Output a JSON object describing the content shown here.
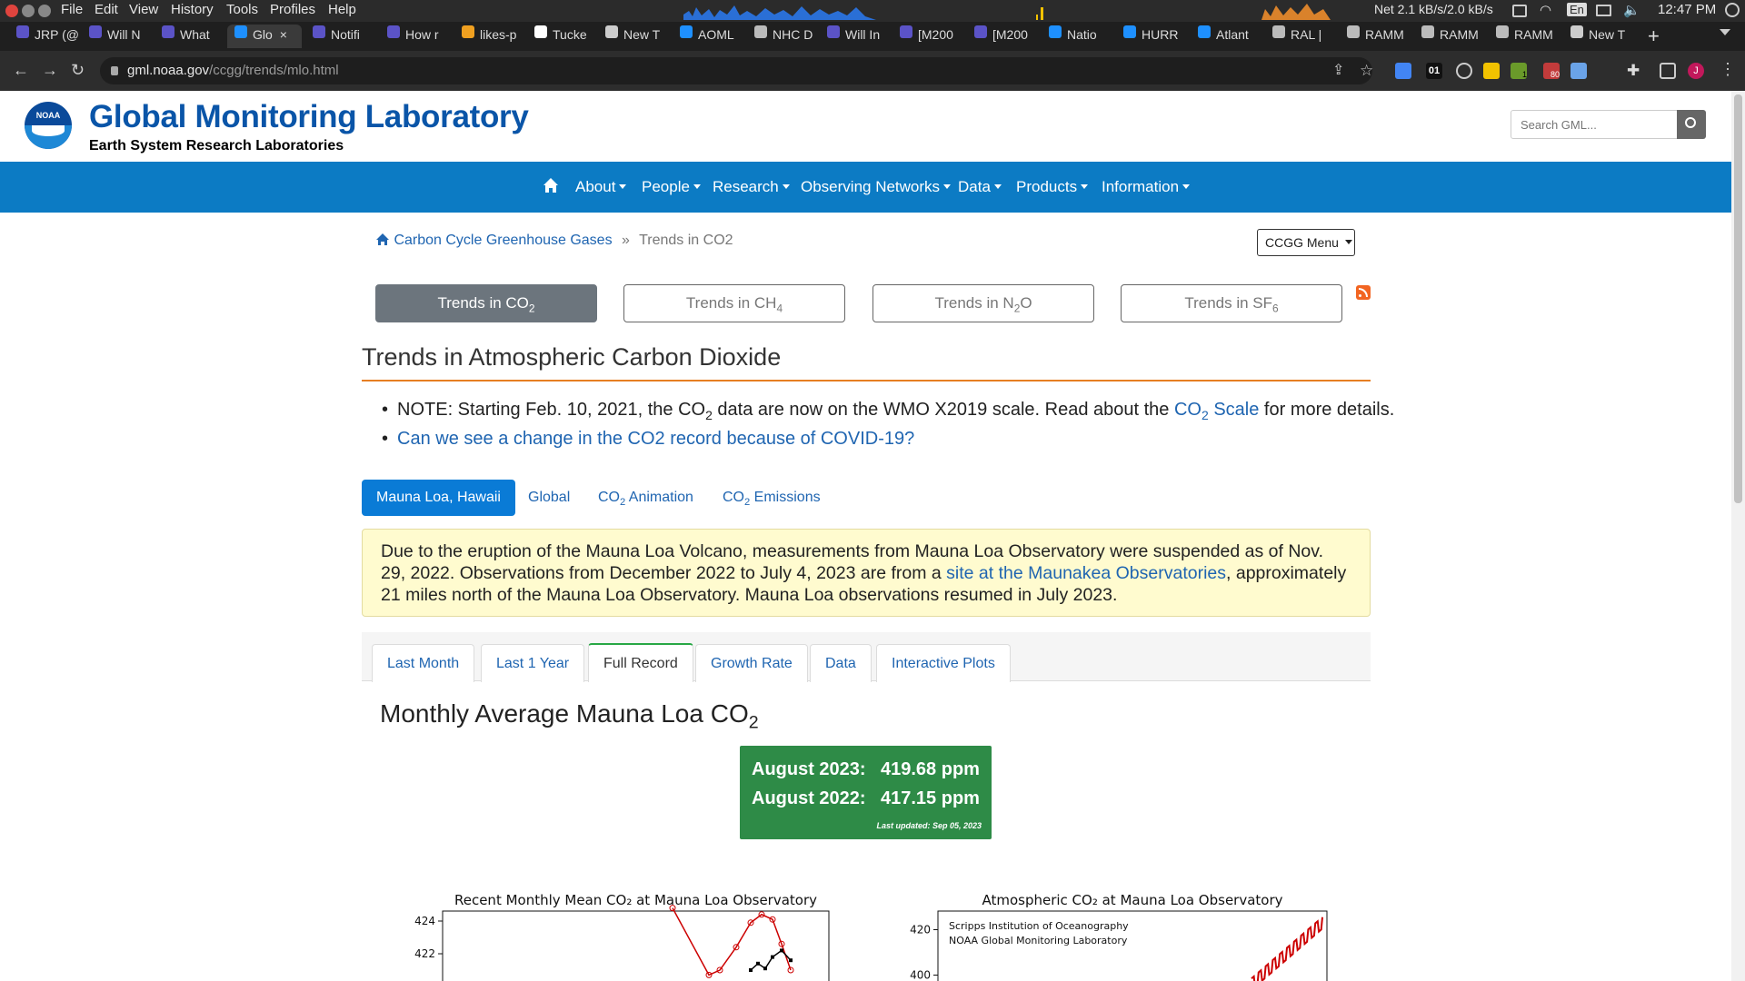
{
  "os": {
    "menu": [
      "File",
      "Edit",
      "View",
      "History",
      "Tools",
      "Profiles",
      "Help"
    ],
    "net": "Net 2.1 kB/s/2.0 kB/s",
    "lang": "En",
    "clock": "12:47 PM"
  },
  "tabs": [
    {
      "label": "JRP (@",
      "color": "#5b53c7"
    },
    {
      "label": "Will N",
      "color": "#5b53c7"
    },
    {
      "label": "What",
      "color": "#5b53c7"
    },
    {
      "label": "Glo",
      "color": "#1e90ff",
      "active": true
    },
    {
      "label": "Notifi",
      "color": "#5b53c7"
    },
    {
      "label": "How r",
      "color": "#5b53c7"
    },
    {
      "label": "likes-p",
      "color": "#f0a020"
    },
    {
      "label": "Tucke",
      "color": "#ffffff"
    },
    {
      "label": "New T",
      "color": "#cccccc"
    },
    {
      "label": "AOML",
      "color": "#1e90ff"
    },
    {
      "label": "NHC D",
      "color": "#bbbbbb"
    },
    {
      "label": "Will In",
      "color": "#5b53c7"
    },
    {
      "label": "[M200",
      "color": "#5b53c7"
    },
    {
      "label": "[M200",
      "color": "#5b53c7"
    },
    {
      "label": "Natio",
      "color": "#1e90ff"
    },
    {
      "label": "HURR",
      "color": "#1e90ff"
    },
    {
      "label": "Atlant",
      "color": "#1e90ff"
    },
    {
      "label": "RAL |",
      "color": "#bbbbbb"
    },
    {
      "label": "RAMM",
      "color": "#bbbbbb"
    },
    {
      "label": "RAMM",
      "color": "#bbbbbb"
    },
    {
      "label": "RAMM",
      "color": "#bbbbbb"
    },
    {
      "label": "New T",
      "color": "#cccccc"
    }
  ],
  "browser": {
    "url_host": "gml.noaa.gov",
    "url_path": "/ccgg/trends/mlo.html",
    "tab_close": "×",
    "new_tab": "+",
    "ext_badge_1": "01",
    "ext_badge_2": "1",
    "ext_badge_3": "80",
    "profile_initial": "J"
  },
  "site": {
    "title": "Global Monitoring Laboratory",
    "subtitle": "Earth System Research Laboratories",
    "logo_text": "NOAA",
    "search_placeholder": "Search GML...",
    "nav": [
      "About",
      "People",
      "Research",
      "Observing Networks",
      "Data",
      "Products",
      "Information"
    ]
  },
  "breadcrumb": {
    "home": "Carbon Cycle Greenhouse Gases",
    "sep": "»",
    "current": "Trends in CO2",
    "menu_button": "CCGG Menu"
  },
  "subtabs": [
    {
      "text": "Trends in CO",
      "sub": "2"
    },
    {
      "text": "Trends in CH",
      "sub": "4"
    },
    {
      "text": "Trends in N",
      "sub": "2",
      "tail": "O"
    },
    {
      "text": "Trends in SF",
      "sub": "6"
    }
  ],
  "heading": "Trends in Atmospheric Carbon Dioxide",
  "notes": {
    "n1_a": "NOTE: Starting Feb. 10, 2021, the CO",
    "n1_sub": "2",
    "n1_b": " data are now on the WMO X2019 scale. Read about the ",
    "n1_link": "CO",
    "n1_link_sub": "2",
    "n1_link_b": " Scale",
    "n1_c": " for more details.",
    "n2_link": "Can we see a change in the CO2 record because of COVID-19?"
  },
  "pills": [
    {
      "text": "Mauna Loa, Hawaii"
    },
    {
      "text": "Global"
    },
    {
      "text": "CO",
      "sub": "2",
      "tail": " Animation"
    },
    {
      "text": "CO",
      "sub": "2",
      "tail": " Emissions"
    }
  ],
  "alert": {
    "a": "Due to the eruption of the Mauna Loa Volcano, measurements from Mauna Loa Observatory were suspended as of Nov. 29, 2022. Observations from December 2022 to July 4, 2023 are from a ",
    "link": "site at the Maunakea Observatories",
    "b": ", approximately 21 miles north of the Mauna Loa Observatory. Mauna Loa observations resumed in July 2023."
  },
  "record_tabs": [
    "Last Month",
    "Last 1 Year",
    "Full Record",
    "Growth Rate",
    "Data",
    "Interactive Plots"
  ],
  "monthly": {
    "title_a": "Monthly Average Mauna Loa CO",
    "title_sub": "2",
    "row1_label": "August 2023:",
    "row1_value": "419.68 ppm",
    "row2_label": "August 2022:",
    "row2_value": "417.15 ppm",
    "updated": "Last updated: Sep 05, 2023"
  },
  "chart_data": [
    {
      "type": "line",
      "title": "Recent Monthly Mean CO₂ at Mauna Loa Observatory",
      "ylim": [
        420,
        425
      ],
      "yticks": [
        422,
        424
      ],
      "series": [
        {
          "color": "#cc0000",
          "marker": "circle"
        },
        {
          "color": "#000000",
          "marker": "square"
        }
      ]
    },
    {
      "type": "line",
      "title": "Atmospheric CO₂ at Mauna Loa Observatory",
      "ylim": [
        395,
        425
      ],
      "yticks": [
        400,
        420
      ],
      "legend": [
        "Scripps Institution of Oceanography",
        "NOAA Global Monitoring Laboratory"
      ],
      "series": [
        {
          "color": "#cc0000"
        }
      ]
    }
  ]
}
